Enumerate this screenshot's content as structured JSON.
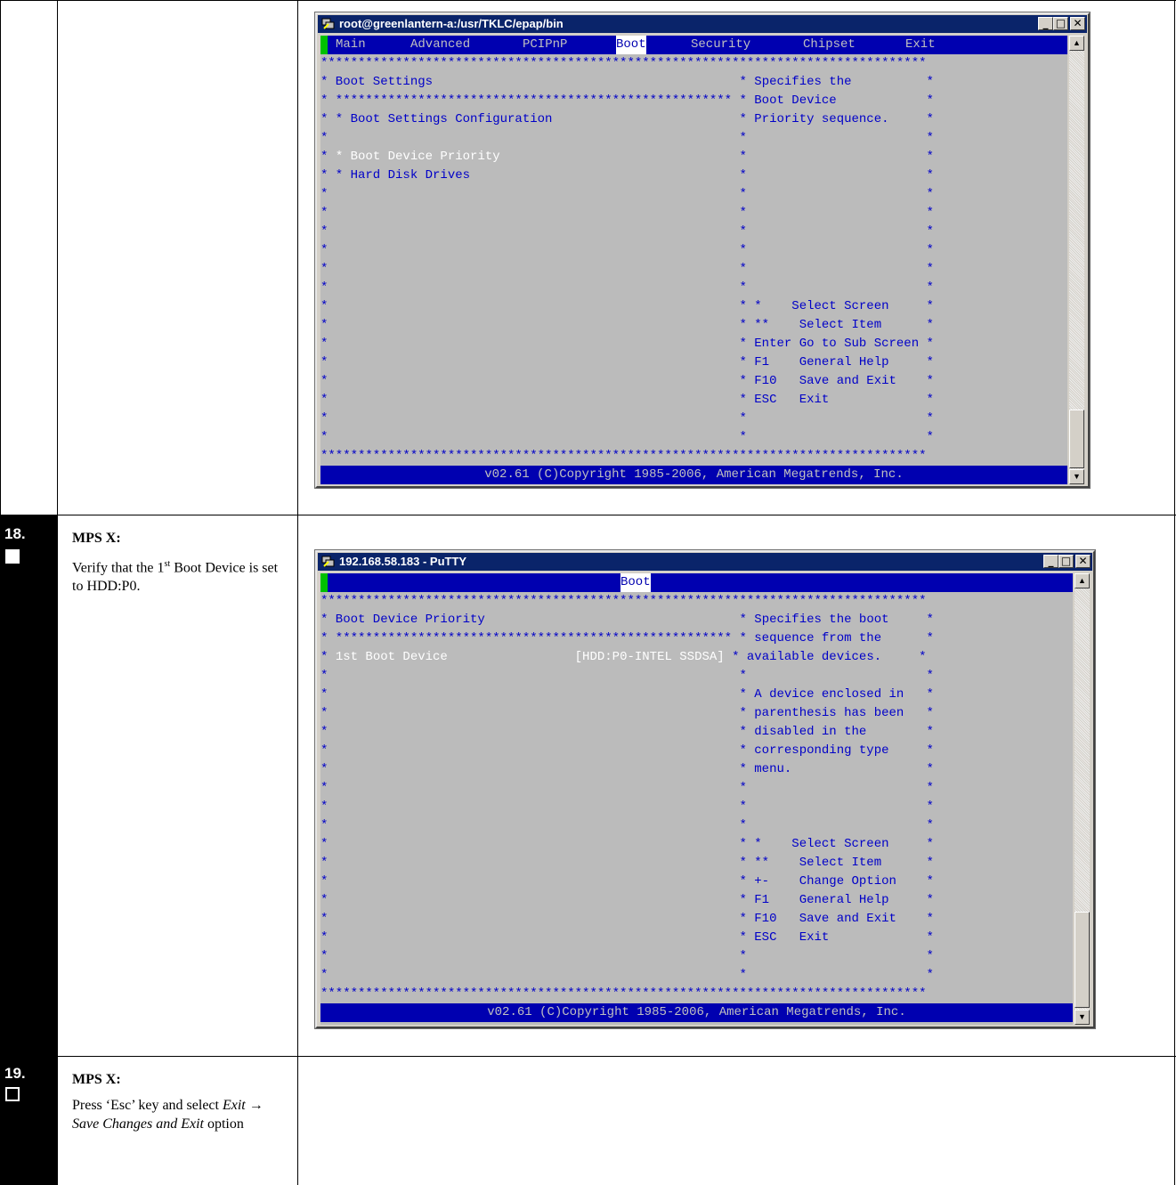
{
  "window1": {
    "title": "root@greenlantern-a:/usr/TKLC/epap/bin",
    "menu": [
      "Main",
      "Advanced",
      "PCIPnP",
      "Boot",
      "Security",
      "Chipset",
      "Exit"
    ],
    "active_menu": "Boot",
    "lines": {
      "stars_top": "*********************************************************************************",
      "l1": "* Boot Settings                                         * Specifies the          *",
      "l2": "* ***************************************************** * Boot Device            *",
      "l3": "* * Boot Settings Configuration                         * Priority sequence.     *",
      "l4": "*                                                       *                        *",
      "l5a": "* ",
      "l5b": "* Boot Device Priority",
      "l5c": "                                *                        *",
      "l6": "* * Hard Disk Drives                                    *                        *",
      "blank": "*                                                       *                        *",
      "k1": "*                                                       * *    Select Screen     *",
      "k2": "*                                                       * **    Select Item      *",
      "k3": "*                                                       * Enter Go to Sub Screen *",
      "k4": "*                                                       * F1    General Help     *",
      "k5": "*                                                       * F10   Save and Exit    *",
      "k6": "*                                                       * ESC   Exit             *",
      "stars_bottom": "*********************************************************************************"
    },
    "status": "v02.61 (C)Copyright 1985-2006, American Megatrends, Inc."
  },
  "step18": {
    "number": "18.",
    "heading": "MPS X:",
    "text_a": "Verify that the 1",
    "sup": "st",
    "text_b": " Boot Device is set to HDD:P0."
  },
  "window2": {
    "title": "192.168.58.183 - PuTTY",
    "active_menu": "Boot",
    "lines": {
      "stars_top": "*********************************************************************************",
      "l1": "* Boot Device Priority                                  * Specifies the boot     *",
      "l2": "* ***************************************************** * sequence from the      *",
      "l3a": "* ",
      "l3b": "1st Boot Device                 [HDD:P0-INTEL SSDSA]",
      "l3c": " * available devices.     *",
      "l4": "*                                                       *                        *",
      "l5": "*                                                       * A device enclosed in   *",
      "l6": "*                                                       * parenthesis has been   *",
      "l7": "*                                                       * disabled in the        *",
      "l8": "*                                                       * corresponding type     *",
      "l9": "*                                                       * menu.                  *",
      "blank": "*                                                       *                        *",
      "k1": "*                                                       * *    Select Screen     *",
      "k2": "*                                                       * **    Select Item      *",
      "k3": "*                                                       * +-    Change Option    *",
      "k4": "*                                                       * F1    General Help     *",
      "k5": "*                                                       * F10   Save and Exit    *",
      "k6": "*                                                       * ESC   Exit             *",
      "stars_bottom": "*********************************************************************************"
    },
    "status": "v02.61 (C)Copyright 1985-2006, American Megatrends, Inc."
  },
  "step19": {
    "number": "19.",
    "heading": "MPS X:",
    "text_a": "Press ‘Esc’ key and select ",
    "italic": "Exit → Save Changes and Exit",
    "text_b": " option"
  }
}
